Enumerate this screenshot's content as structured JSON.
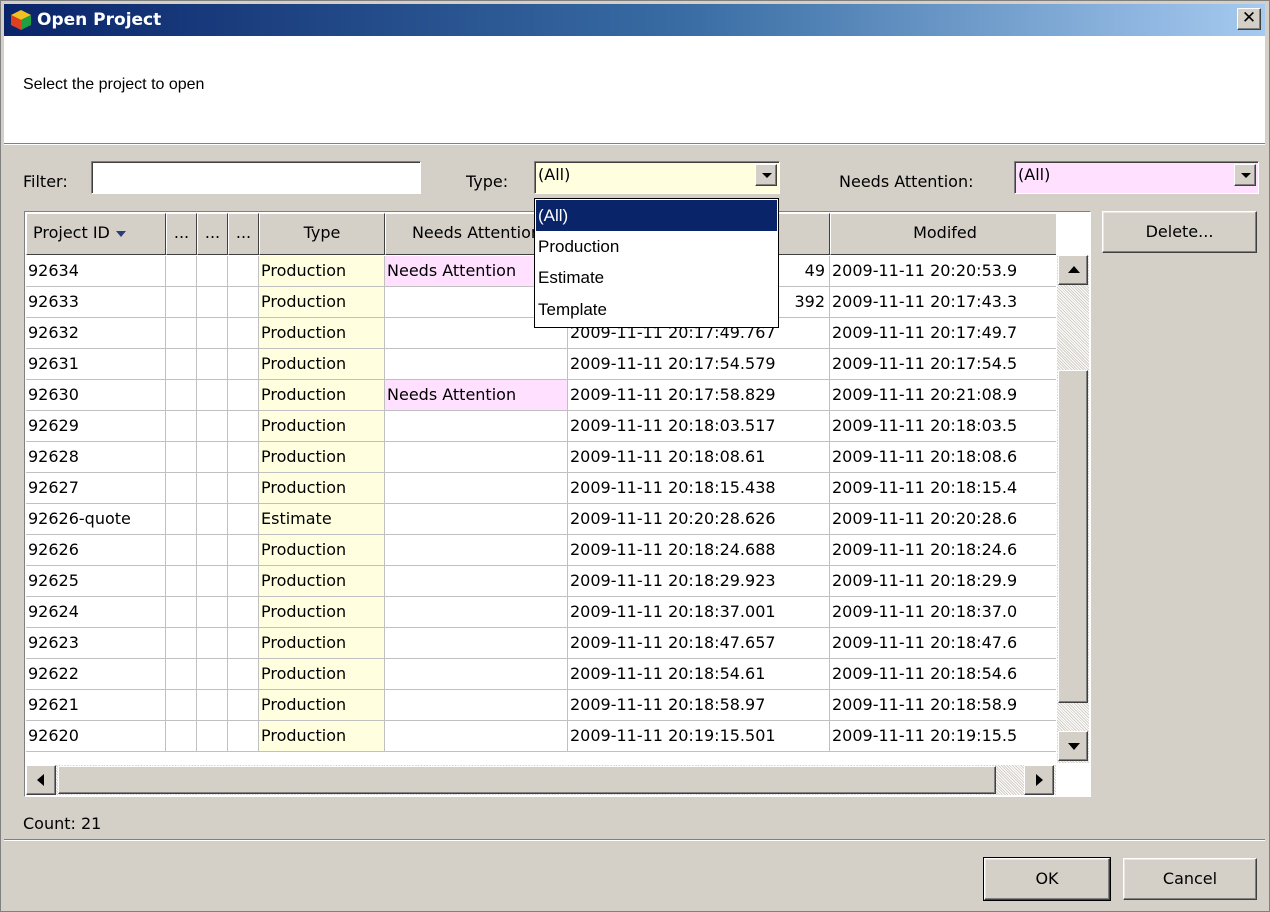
{
  "dialog": {
    "title": "Open Project",
    "header_text": "Select the project to open"
  },
  "filters": {
    "filter_label": "Filter:",
    "filter_value": "",
    "type_label": "Type:",
    "type_value": "(All)",
    "type_options": [
      "(All)",
      "Production",
      "Estimate",
      "Template"
    ],
    "attention_label": "Needs Attention:",
    "attention_value": "(All)"
  },
  "table": {
    "columns": [
      "Project ID",
      "...",
      "...",
      "...",
      "Type",
      "Needs Attention",
      "",
      "Modifed"
    ],
    "rows": [
      {
        "id": "92634",
        "type": "Production",
        "attention": "Needs Attention",
        "created": "49",
        "modified": "2009-11-11 20:20:53.9"
      },
      {
        "id": "92633",
        "type": "Production",
        "attention": "",
        "created": "392",
        "modified": "2009-11-11 20:17:43.3"
      },
      {
        "id": "92632",
        "type": "Production",
        "attention": "",
        "created": "2009-11-11 20:17:49.767",
        "modified": "2009-11-11 20:17:49.7"
      },
      {
        "id": "92631",
        "type": "Production",
        "attention": "",
        "created": "2009-11-11 20:17:54.579",
        "modified": "2009-11-11 20:17:54.5"
      },
      {
        "id": "92630",
        "type": "Production",
        "attention": "Needs Attention",
        "created": "2009-11-11 20:17:58.829",
        "modified": "2009-11-11 20:21:08.9"
      },
      {
        "id": "92629",
        "type": "Production",
        "attention": "",
        "created": "2009-11-11 20:18:03.517",
        "modified": "2009-11-11 20:18:03.5"
      },
      {
        "id": "92628",
        "type": "Production",
        "attention": "",
        "created": "2009-11-11 20:18:08.61",
        "modified": "2009-11-11 20:18:08.6"
      },
      {
        "id": "92627",
        "type": "Production",
        "attention": "",
        "created": "2009-11-11 20:18:15.438",
        "modified": "2009-11-11 20:18:15.4"
      },
      {
        "id": "92626-quote",
        "type": "Estimate",
        "attention": "",
        "created": "2009-11-11 20:20:28.626",
        "modified": "2009-11-11 20:20:28.6"
      },
      {
        "id": "92626",
        "type": "Production",
        "attention": "",
        "created": "2009-11-11 20:18:24.688",
        "modified": "2009-11-11 20:18:24.6"
      },
      {
        "id": "92625",
        "type": "Production",
        "attention": "",
        "created": "2009-11-11 20:18:29.923",
        "modified": "2009-11-11 20:18:29.9"
      },
      {
        "id": "92624",
        "type": "Production",
        "attention": "",
        "created": "2009-11-11 20:18:37.001",
        "modified": "2009-11-11 20:18:37.0"
      },
      {
        "id": "92623",
        "type": "Production",
        "attention": "",
        "created": "2009-11-11 20:18:47.657",
        "modified": "2009-11-11 20:18:47.6"
      },
      {
        "id": "92622",
        "type": "Production",
        "attention": "",
        "created": "2009-11-11 20:18:54.61",
        "modified": "2009-11-11 20:18:54.6"
      },
      {
        "id": "92621",
        "type": "Production",
        "attention": "",
        "created": "2009-11-11 20:18:58.97",
        "modified": "2009-11-11 20:18:58.9"
      },
      {
        "id": "92620",
        "type": "Production",
        "attention": "",
        "created": "2009-11-11 20:19:15.501",
        "modified": "2009-11-11 20:19:15.5"
      }
    ]
  },
  "status": {
    "count_text": "Count: 21"
  },
  "buttons": {
    "delete_label": "Delete...",
    "ok_label": "OK",
    "cancel_label": "Cancel"
  },
  "colors": {
    "title_start": "#0a246a",
    "type_cell_bg": "#ffffe0",
    "attention_bg": "#ffe0ff",
    "selection": "#0a246a"
  }
}
